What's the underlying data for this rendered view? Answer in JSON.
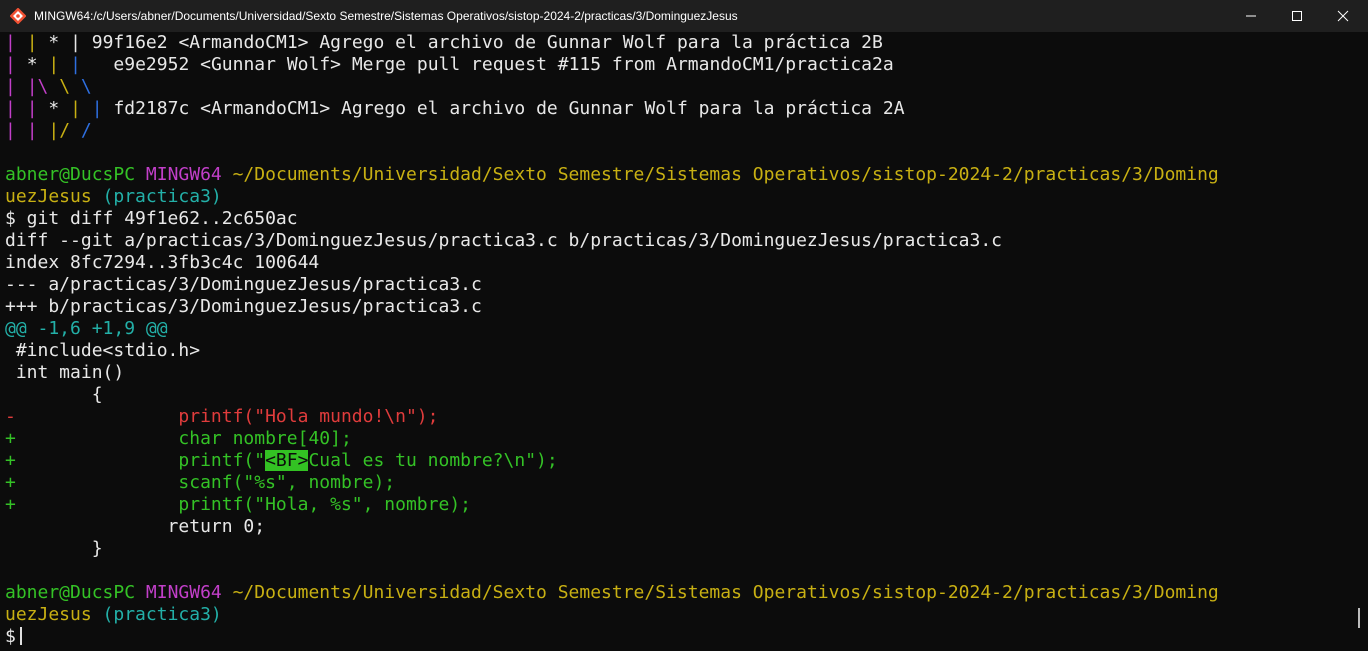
{
  "window": {
    "title": "MINGW64:/c/Users/abner/Documents/Universidad/Sexto Semestre/Sistemas Operativos/sistop-2024-2/practicas/3/DominguezJesus"
  },
  "graph": {
    "l1": {
      "a": "| ",
      "b": "| ",
      "c": "* ",
      "d": "| ",
      "hash": "99f16e2",
      "msg": " <ArmandoCM1> Agrego el archivo de Gunnar Wolf para la práctica 2B"
    },
    "l2": {
      "a": "| ",
      "b": "* ",
      "c": "| ",
      "d": "|   ",
      "hash": "e9e2952",
      "msg": " <Gunnar Wolf> Merge pull request #115 from ArmandoCM1/practica2a"
    },
    "l3": {
      "a": "| ",
      "b": "|\\ ",
      "c": "\\ ",
      "d": "\\"
    },
    "l4": {
      "a": "| ",
      "b": "| ",
      "c": "* ",
      "d": "| ",
      "e": "| ",
      "hash": "fd2187c",
      "msg": " <ArmandoCM1> Agrego el archivo de Gunnar Wolf para la práctica 2A"
    },
    "l5": {
      "a": "| ",
      "b": "| ",
      "c": "|/ ",
      "d": "/"
    }
  },
  "prompt1": {
    "user": "abner@DucsPC",
    "sys": "MINGW64",
    "path_a": "~/Documents/Universidad/Sexto Semestre/Sistemas Operativos/sistop-2024-2/practicas/3/Doming",
    "path_b": "uezJesus",
    "branch": "(practica3)"
  },
  "command": "$ git diff 49f1e62..2c650ac",
  "diff": {
    "header1": "diff --git a/practicas/3/DominguezJesus/practica3.c b/practicas/3/DominguezJesus/practica3.c",
    "header2": "index 8fc7294..3fb3c4c 100644",
    "header3": "--- a/practicas/3/DominguezJesus/practica3.c",
    "header4": "+++ b/practicas/3/DominguezJesus/practica3.c",
    "hunk": "@@ -1,6 +1,9 @@",
    "ctx1": " #include<stdio.h>",
    "ctx2": " int main()",
    "ctx3": "        {",
    "del_sign": "-",
    "del1": "               printf(\"Hola mundo!\\n\");",
    "add_sign": "+",
    "add1": "               char nombre[40];",
    "add2_a": "               printf(\"",
    "add2_hl": "<BF>",
    "add2_b": "Cual es tu nombre?\\n\");",
    "add3": "               scanf(\"%s\", nombre);",
    "add4": "               printf(\"Hola, %s\", nombre);",
    "ctx4": "               return 0;",
    "ctx5": "        }"
  },
  "prompt2": {
    "user": "abner@DucsPC",
    "sys": "MINGW64",
    "path_a": "~/Documents/Universidad/Sexto Semestre/Sistemas Operativos/sistop-2024-2/practicas/3/Doming",
    "path_b": "uezJesus",
    "branch": "(practica3)",
    "dollar": "$"
  },
  "colors": {
    "background": "#0c0c0c",
    "green": "#34c226",
    "red": "#e03c3c",
    "yellow": "#c8b013",
    "magenta": "#c23fc9",
    "cyan": "#23b0a8"
  }
}
